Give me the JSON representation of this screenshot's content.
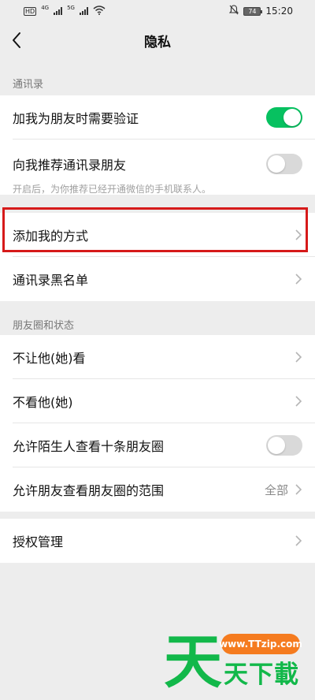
{
  "status_bar": {
    "left_badge": "HD",
    "net1": "4G",
    "net2": "5G",
    "battery": "74",
    "time": "15:20"
  },
  "nav": {
    "title": "隐私"
  },
  "sections": {
    "contacts": {
      "label": "通讯录",
      "verify_label": "加我为朋友时需要验证",
      "verify_on": true,
      "recommend_label": "向我推荐通讯录朋友",
      "recommend_on": false,
      "recommend_hint": "开启后，为你推荐已经开通微信的手机联系人。",
      "add_methods_label": "添加我的方式",
      "blacklist_label": "通讯录黑名单"
    },
    "moments": {
      "label": "朋友圈和状态",
      "hide_from_label": "不让他(她)看",
      "dont_see_label": "不看他(她)",
      "strangers_label": "允许陌生人查看十条朋友圈",
      "strangers_on": false,
      "range_label": "允许朋友查看朋友圈的范围",
      "range_value": "全部"
    },
    "auth": {
      "label": "授权管理"
    }
  },
  "colors": {
    "accent": "#07c160",
    "highlight": "#d61a1a"
  },
  "watermark": {
    "big": "天",
    "url": "www.TTzip.com",
    "small": "天下載"
  }
}
